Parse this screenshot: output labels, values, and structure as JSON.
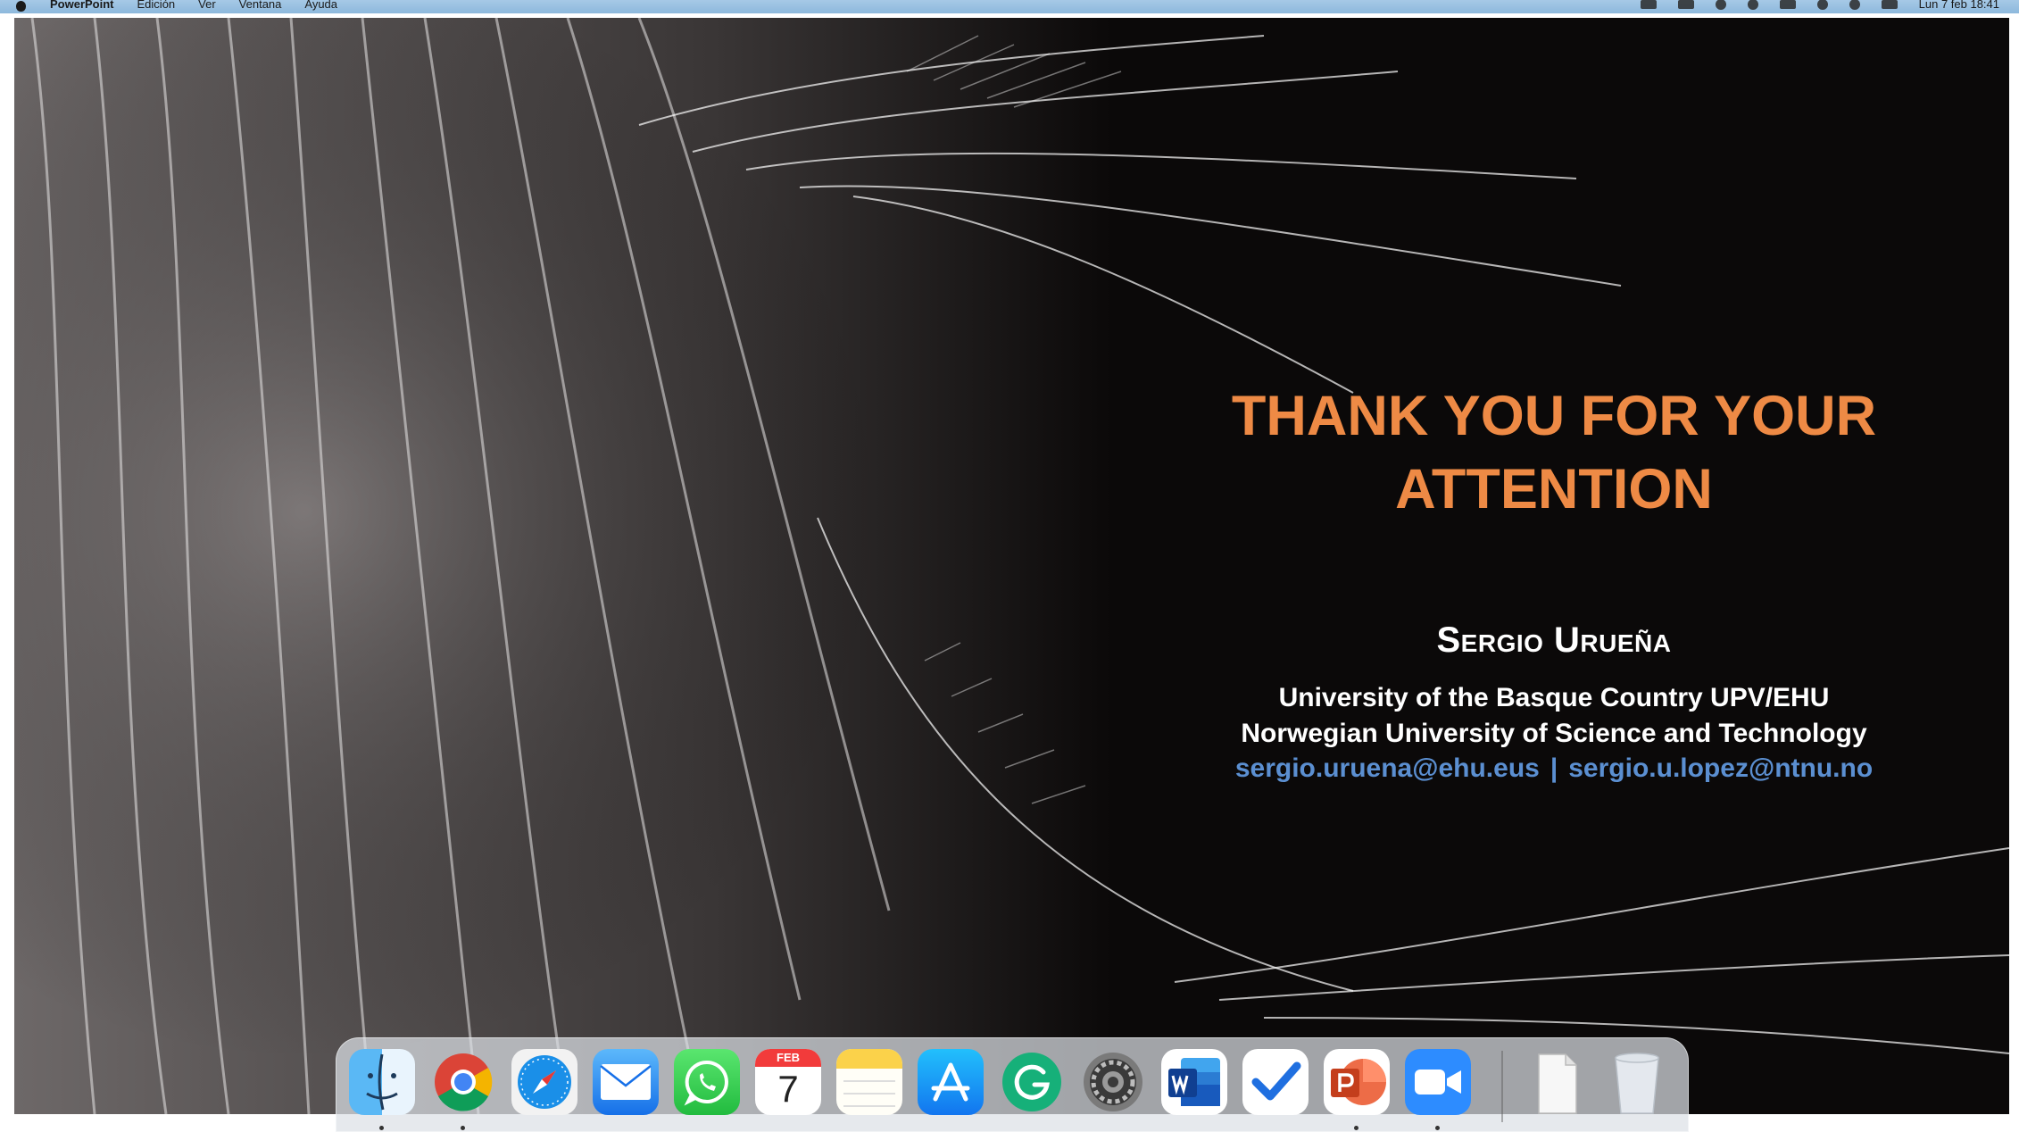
{
  "menubar": {
    "app_name": "PowerPoint",
    "menus": [
      "Edición",
      "Ver",
      "Ventana",
      "Ayuda"
    ],
    "clock": "Lun 7 feb  18:41"
  },
  "slide": {
    "title_line1": "THANK YOU FOR YOUR",
    "title_line2": "ATTENTION",
    "author": "Sergio Urueña",
    "affiliation_1": "University of the Basque Country UPV/EHU",
    "affiliation_2": "Norwegian University of Science and Technology",
    "email_1": "sergio.uruena@ehu.eus",
    "email_separator": "|",
    "email_2": "sergio.u.lopez@ntnu.no",
    "colors": {
      "title": "#ee8a45",
      "text": "#ffffff",
      "email": "#5b8fd1",
      "background": "#0b0909"
    }
  },
  "dock": {
    "calendar_month": "FEB",
    "calendar_day": "7",
    "items": [
      {
        "name": "finder-icon"
      },
      {
        "name": "chrome-icon"
      },
      {
        "name": "safari-icon"
      },
      {
        "name": "mail-icon"
      },
      {
        "name": "whatsapp-icon"
      },
      {
        "name": "calendar-icon"
      },
      {
        "name": "notes-icon"
      },
      {
        "name": "app-store-icon"
      },
      {
        "name": "grammarly-icon"
      },
      {
        "name": "system-preferences-icon"
      },
      {
        "name": "word-icon"
      },
      {
        "name": "tasks-icon"
      },
      {
        "name": "powerpoint-icon"
      },
      {
        "name": "zoom-icon"
      },
      {
        "name": "documents-icon"
      },
      {
        "name": "trash-icon"
      }
    ]
  }
}
